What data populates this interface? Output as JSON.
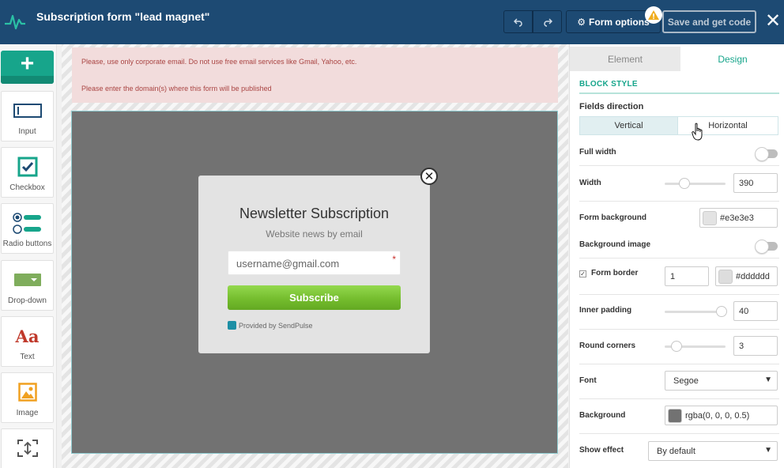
{
  "header": {
    "title": "Subscription form \"lead magnet\"",
    "form_options_label": "Form options",
    "save_label": "Save and get code",
    "warning_icon": "warning-icon"
  },
  "toolbar": {
    "items": [
      {
        "label": "Input",
        "icon": "input-icon"
      },
      {
        "label": "Checkbox",
        "icon": "checkbox-icon"
      },
      {
        "label": "Radio buttons",
        "icon": "radio-icon"
      },
      {
        "label": "Drop-down",
        "icon": "dropdown-icon"
      },
      {
        "label": "Text",
        "icon": "text-icon",
        "glyph": "Aa"
      },
      {
        "label": "Image",
        "icon": "image-icon"
      },
      {
        "label": "",
        "icon": "spacer-icon"
      }
    ]
  },
  "canvas": {
    "notice_line_1": "Please, use only corporate email. Do not use free email services like Gmail, Yahoo, etc.",
    "notice_line_2": "Please enter the domain(s) where this form will be published",
    "popup": {
      "title": "Newsletter Subscription",
      "subtitle": "Website news by email",
      "email_placeholder": "username@gmail.com",
      "required_mark": "*",
      "subscribe_label": "Subscribe",
      "provided_by": "Provided by SendPulse"
    }
  },
  "panel": {
    "tabs": [
      {
        "label": "Element",
        "active": false
      },
      {
        "label": "Design",
        "active": true
      }
    ],
    "section_title": "BLOCK STYLE",
    "fields_direction": {
      "label": "Fields direction",
      "options": [
        "Vertical",
        "Horizontal"
      ],
      "selected": "Vertical"
    },
    "full_width": {
      "label": "Full width",
      "on": false
    },
    "width": {
      "label": "Width",
      "value": "390",
      "slider_fraction": 0.3
    },
    "form_background": {
      "label": "Form background",
      "value": "#e3e3e3",
      "color": "#e3e3e3"
    },
    "background_image": {
      "label": "Background image",
      "on": false
    },
    "form_border": {
      "label": "Form border",
      "checked": true,
      "width": "1",
      "color_value": "#dddddd",
      "color": "#dddddd"
    },
    "inner_padding": {
      "label": "Inner padding",
      "value": "40",
      "slider_fraction": 1.0
    },
    "round_corners": {
      "label": "Round corners",
      "value": "3",
      "slider_fraction": 0.15
    },
    "font": {
      "label": "Font",
      "value": "Segoe"
    },
    "background": {
      "label": "Background",
      "value": "rgba(0, 0, 0, 0.5)",
      "color": "#727272"
    },
    "show_effect": {
      "label": "Show effect",
      "value": "By default"
    }
  },
  "colors": {
    "header": "#1d4a73",
    "accent": "#17a58b",
    "subscribe": "#75bd2e"
  }
}
